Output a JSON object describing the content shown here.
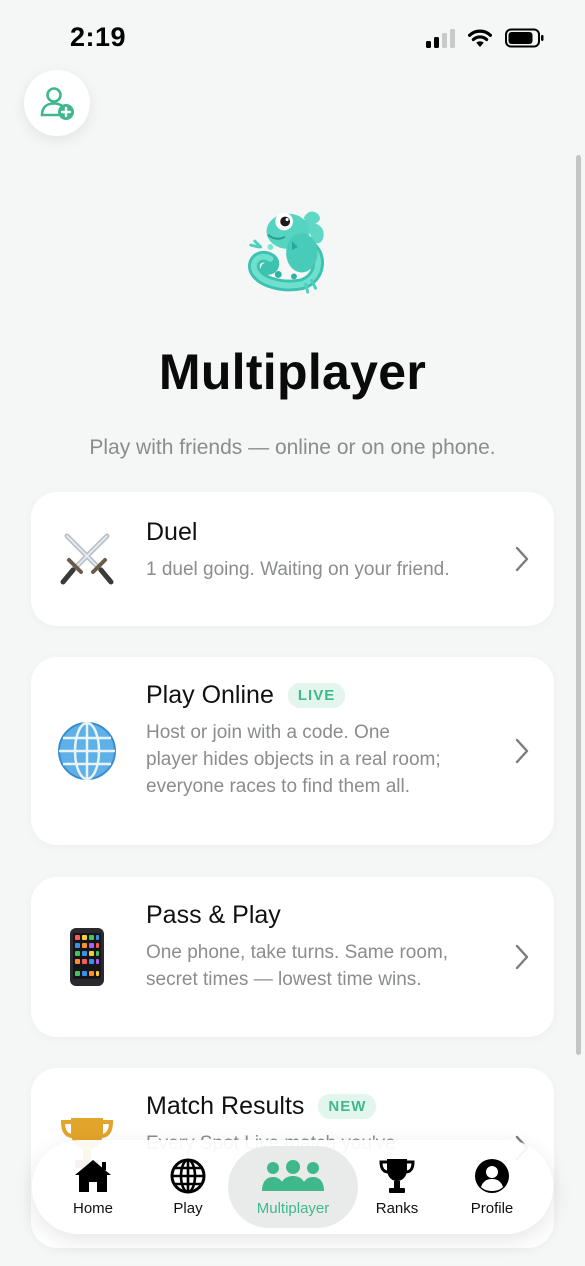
{
  "status_bar": {
    "time": "2:19"
  },
  "header": {
    "add_friend_icon": "person-add-icon"
  },
  "hero": {
    "title": "Multiplayer",
    "subtitle": "Play with friends — online or on one phone."
  },
  "modes": [
    {
      "title": "Duel",
      "badge": "",
      "description": "1 duel going. Waiting on your friend.",
      "icon": "crossed-swords-icon"
    },
    {
      "title": "Play Online",
      "badge": "LIVE",
      "description": "Host or join with a code. One player hides objects in a real room; everyone races to find them all.",
      "icon": "globe-icon"
    },
    {
      "title": "Pass & Play",
      "badge": "",
      "description": "One phone, take turns. Same room, secret times — lowest time wins.",
      "icon": "phone-icon"
    },
    {
      "title": "Match Results",
      "badge": "NEW",
      "description": "Every Spot Live match you've",
      "icon": "trophy-icon"
    }
  ],
  "tab_bar": {
    "tabs": [
      {
        "label": "Home",
        "icon": "home-icon"
      },
      {
        "label": "Play",
        "icon": "globe-icon"
      },
      {
        "label": "Multiplayer",
        "icon": "group-icon",
        "active": true
      },
      {
        "label": "Ranks",
        "icon": "trophy-icon"
      },
      {
        "label": "Profile",
        "icon": "profile-icon"
      }
    ]
  },
  "colors": {
    "accent": "#3fb98c",
    "background": "#f5f6f6",
    "card": "#ffffff",
    "muted_text": "#8a8c8e"
  }
}
